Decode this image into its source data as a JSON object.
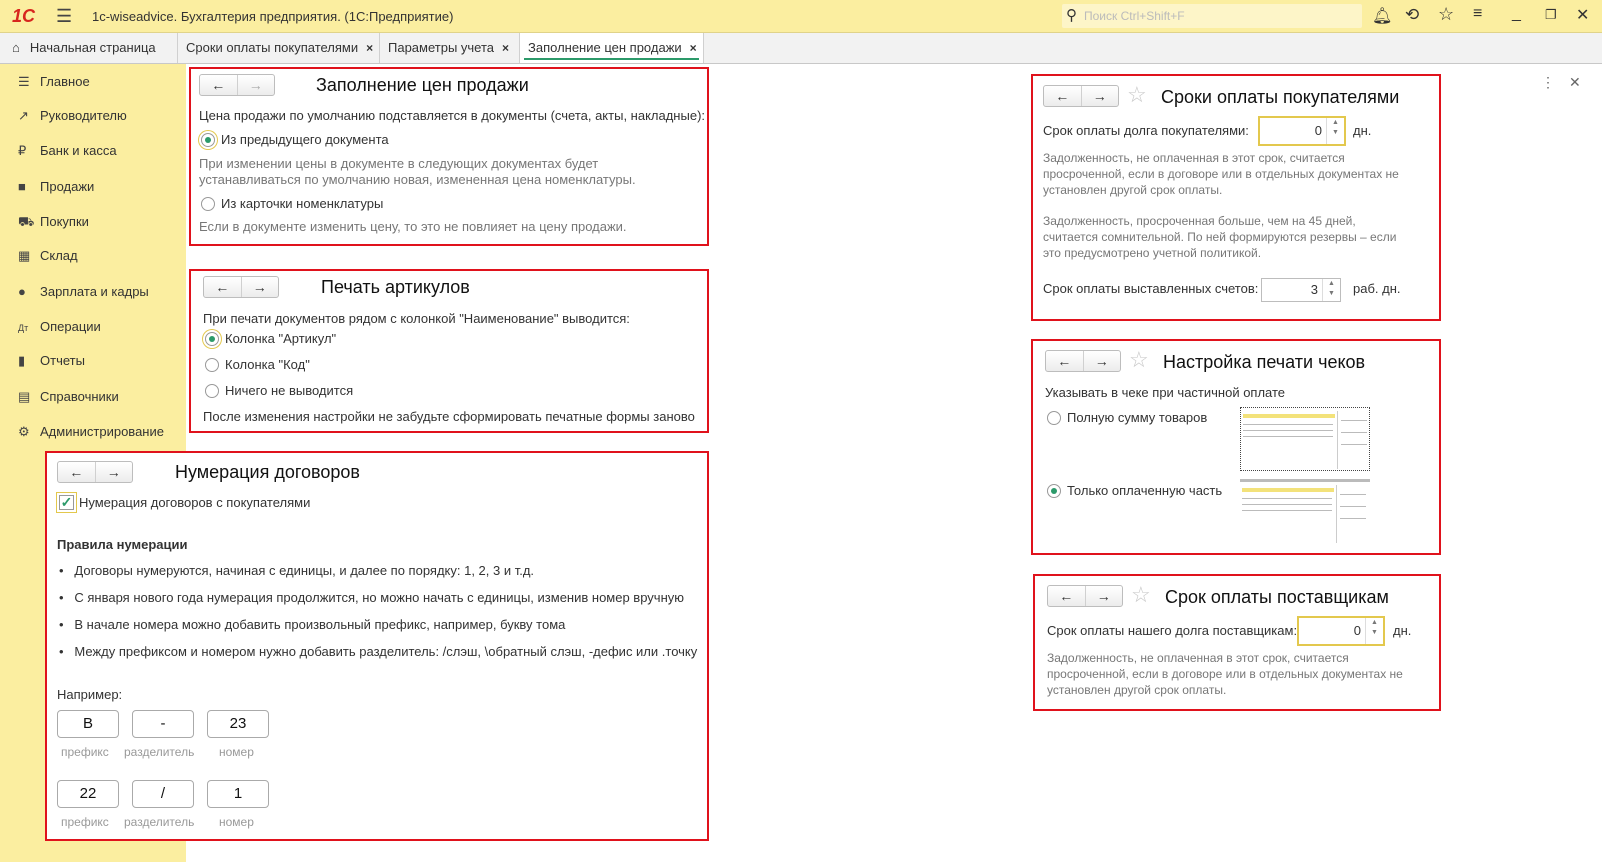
{
  "titlebar": {
    "logo": "1С",
    "title": "1c-wiseadvice. Бухгалтерия предприятия.  (1С:Предприятие)",
    "search_placeholder": "Поиск Ctrl+Shift+F"
  },
  "tabs": [
    {
      "label": "Начальная страница"
    },
    {
      "label": "Сроки оплаты покупателями",
      "close": "×"
    },
    {
      "label": "Параметры учета",
      "close": "×"
    },
    {
      "label": "Заполнение цен продажи",
      "close": "×",
      "active": true
    }
  ],
  "sidebar": {
    "items": [
      {
        "label": "Главное",
        "icon": "menu-icon"
      },
      {
        "label": "Руководителю",
        "icon": "trend-icon"
      },
      {
        "label": "Банк и касса",
        "icon": "ruble-icon"
      },
      {
        "label": "Продажи",
        "icon": "bag-icon"
      },
      {
        "label": "Покупки",
        "icon": "cart-icon"
      },
      {
        "label": "Склад",
        "icon": "warehouse-icon"
      },
      {
        "label": "Зарплата и кадры",
        "icon": "person-icon"
      },
      {
        "label": "Операции",
        "icon": "operations-icon"
      },
      {
        "label": "Отчеты",
        "icon": "chart-icon"
      },
      {
        "label": "Справочники",
        "icon": "book-icon"
      },
      {
        "label": "Администрирование",
        "icon": "gear-icon"
      }
    ]
  },
  "price": {
    "title": "Заполнение цен продажи",
    "prompt": "Цена продажи по умолчанию подставляется в документы (счета, акты, накладные):",
    "opt1": "Из предыдущего документа",
    "opt1_hint1": "При изменении цены в документе в следующих документах будет",
    "opt1_hint2": "устанавливаться по умолчанию новая, измененная цена номенклатуры.",
    "opt2": "Из карточки номенклатуры",
    "opt2_hint": "Если в документе изменить цену, то это не повлияет на цену продажи.",
    "selected": "opt1"
  },
  "articles": {
    "title": "Печать артикулов",
    "prompt": "При печати документов рядом с колонкой \"Наименование\" выводится:",
    "opt1": "Колонка \"Артикул\"",
    "opt2": "Колонка \"Код\"",
    "opt3": "Ничего не выводится",
    "note": "После изменения настройки не забудьте сформировать печатные формы заново",
    "selected": "opt1"
  },
  "contracts": {
    "title": "Нумерация договоров",
    "checkbox": "Нумерация договоров с покупателями",
    "checked": true,
    "rules_title": "Правила нумерации",
    "rules": [
      "Договоры нумеруются, начиная с единицы, и далее по порядку: 1, 2, 3 и т.д.",
      "С января нового года нумерация продолжится, но можно начать с единицы, изменив номер вручную",
      "В начале номера можно добавить произвольный префикс, например, букву тома",
      "Между префиксом и номером нужно добавить разделитель: /слэш, \\обратный слэш, -дефис или .точку"
    ],
    "example_label": "Например:",
    "ex1": [
      "В",
      "-",
      "23"
    ],
    "ex2": [
      "22",
      "/",
      "1"
    ],
    "captions": [
      "префикс",
      "разделитель",
      "номер"
    ]
  },
  "customers": {
    "title": "Сроки оплаты покупателями",
    "debt_label": "Срок оплаты долга покупателями:",
    "debt_value": "0",
    "debt_unit": "дн.",
    "hint1": [
      "Задолженность, не оплаченная в этот срок, считается",
      "просроченной, если в договоре или в отдельных документах не",
      "установлен другой срок оплаты."
    ],
    "hint2": [
      "Задолженность, просроченная больше, чем на 45 дней,",
      "считается сомнительной. По ней формируются резервы – если",
      "это предусмотрено учетной политикой."
    ],
    "invoice_label": "Срок оплаты выставленных счетов:",
    "invoice_value": "3",
    "invoice_unit": "раб. дн."
  },
  "receipts": {
    "title": "Настройка печати чеков",
    "prompt": "Указывать в чеке при частичной оплате",
    "opt1": "Полную сумму товаров",
    "opt2": "Только оплаченную часть",
    "selected": "opt2"
  },
  "suppliers": {
    "title": "Срок оплаты поставщикам",
    "label": "Срок оплаты нашего долга поставщикам:",
    "value": "0",
    "unit": "дн.",
    "hint": [
      "Задолженность, не оплаченная в этот срок, считается",
      "просроченной, если в договоре или в отдельных документах не",
      "установлен другой срок оплаты."
    ]
  },
  "colors": {
    "accent": "#2c9a6a",
    "highlight": "#e0121c",
    "sidebar": "#fbeea0"
  }
}
